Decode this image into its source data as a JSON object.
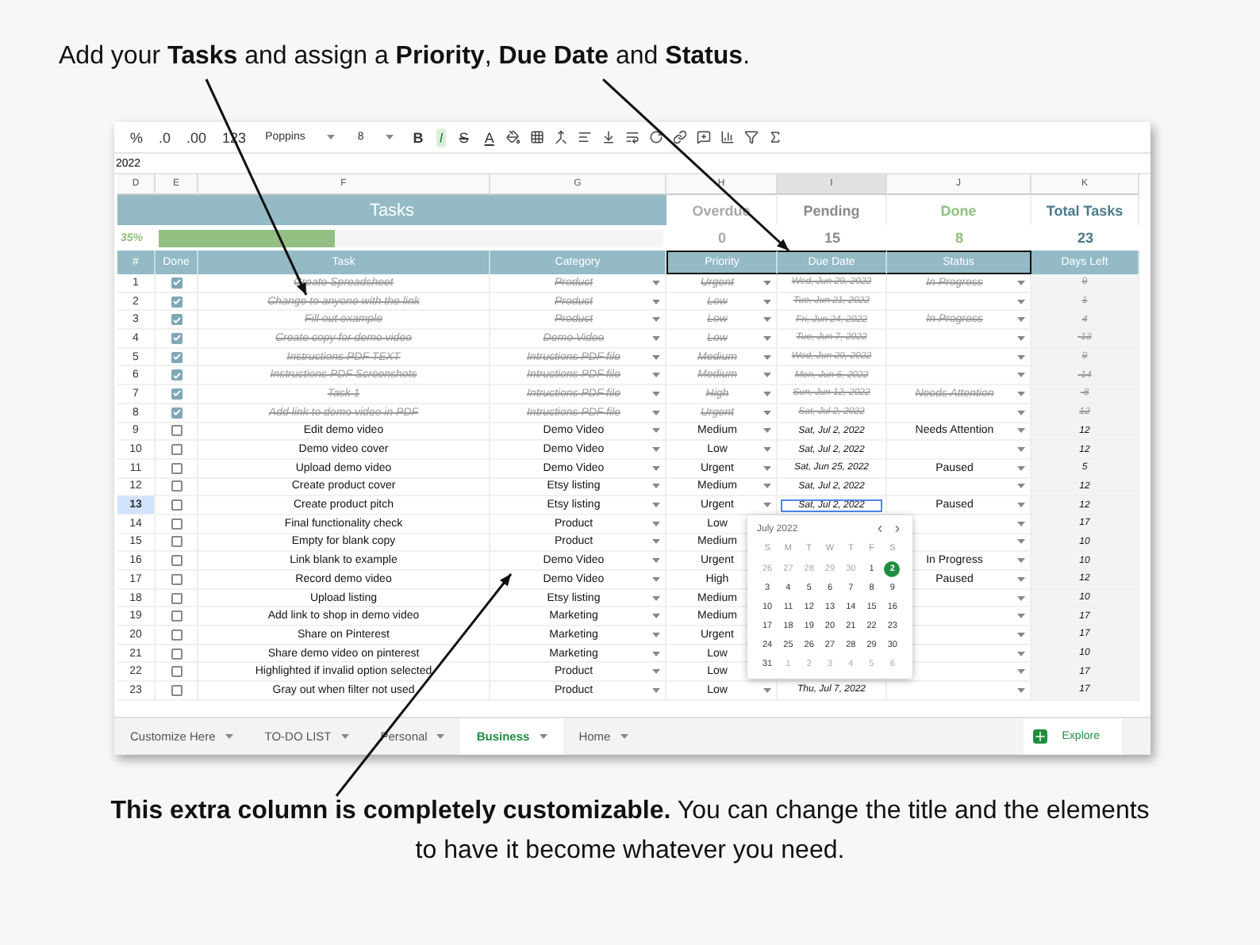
{
  "heading": "Add your **Tasks** and assign a **Priority**, **Due Date** and **Status**.",
  "toolbar": {
    "number_formats": [
      "%",
      ".0",
      ".00",
      "123"
    ],
    "font": "Poppins",
    "font_size": "8",
    "styles": [
      {
        "label": "B",
        "kind": "bold",
        "selected": false
      },
      {
        "label": "I",
        "kind": "italic",
        "selected": true
      },
      {
        "label": "S",
        "kind": "strike",
        "selected": false
      },
      {
        "label": "A",
        "kind": "color",
        "selected": false
      }
    ]
  },
  "formula_bar": "2022",
  "column_letters": [
    {
      "label": "D",
      "selected": false
    },
    {
      "label": "E",
      "selected": false
    },
    {
      "label": "F",
      "selected": false
    },
    {
      "label": "G",
      "selected": false
    },
    {
      "label": "H",
      "selected": false
    },
    {
      "label": "I",
      "selected": true
    },
    {
      "label": "J",
      "selected": false
    },
    {
      "label": "K",
      "selected": false
    }
  ],
  "title": "Tasks",
  "progress": {
    "label": "35%",
    "level": 0.35
  },
  "stats": [
    {
      "label": "Overdue",
      "value": "0",
      "color": "#a9a9a9"
    },
    {
      "label": "Pending",
      "value": "15",
      "color": "#8a8a8a"
    },
    {
      "label": "Done",
      "value": "8",
      "color": "#8fbf7f"
    },
    {
      "label": "Total Tasks",
      "value": "23",
      "color": "#4a7a88"
    }
  ],
  "columns": [
    {
      "label": "#",
      "highlighted": false
    },
    {
      "label": "Done",
      "highlighted": false
    },
    {
      "label": "Task",
      "highlighted": false
    },
    {
      "label": "Category",
      "highlighted": false
    },
    {
      "label": "Priority",
      "highlighted": true
    },
    {
      "label": "Due Date",
      "highlighted": true
    },
    {
      "label": "Status",
      "highlighted": true
    },
    {
      "label": "Days Left",
      "highlighted": false
    }
  ],
  "rows": [
    {
      "n": "1",
      "done": true,
      "task": "Create Spreadsheet",
      "category": "Product",
      "priority": "Urgent",
      "due": "Wed, Jun 29, 2022",
      "status": "In Progress",
      "days": "9",
      "selected": false
    },
    {
      "n": "2",
      "done": true,
      "task": "Change to anyone with the link",
      "category": "Product",
      "priority": "Low",
      "due": "Tue, Jun 21, 2022",
      "days": "1",
      "selected": false
    },
    {
      "n": "3",
      "done": true,
      "task": "Fill out example",
      "category": "Product",
      "priority": "Low",
      "due": "Fri, Jun 24, 2022",
      "status": "In Progress",
      "days": "4",
      "selected": false
    },
    {
      "n": "4",
      "done": true,
      "task": "Create copy for demo video",
      "category": "Demo Video",
      "priority": "Low",
      "due": "Tue, Jun 7, 2022",
      "days": "-13",
      "selected": false
    },
    {
      "n": "5",
      "done": true,
      "task": "Instructions PDF TEXT",
      "category": "Intructions PDF file",
      "priority": "Medium",
      "due": "Wed, Jun 29, 2022",
      "days": "9",
      "selected": false
    },
    {
      "n": "6",
      "done": true,
      "task": "Instructions PDF Screenshots",
      "category": "Intructions PDF file",
      "priority": "Medium",
      "due": "Mon, Jun 6, 2022",
      "days": "-14",
      "selected": false
    },
    {
      "n": "7",
      "done": true,
      "task": "Task 1",
      "category": "Intructions PDF file",
      "priority": "High",
      "due": "Sun, Jun 12, 2022",
      "status": "Needs Attention",
      "days": "-8",
      "selected": false
    },
    {
      "n": "8",
      "done": true,
      "task": "Add link to demo video in PDF",
      "category": "Intructions PDF file",
      "priority": "Urgent",
      "due": "Sat, Jul 2, 2022",
      "days": "12",
      "selected": false
    },
    {
      "n": "9",
      "done": false,
      "task": "Edit demo video",
      "category": "Demo Video",
      "priority": "Medium",
      "due": "Sat, Jul 2, 2022",
      "status": "Needs Attention",
      "days": "12",
      "selected": false
    },
    {
      "n": "10",
      "done": false,
      "task": "Demo video cover",
      "category": "Demo Video",
      "priority": "Low",
      "due": "Sat, Jul 2, 2022",
      "days": "12",
      "selected": false
    },
    {
      "n": "11",
      "done": false,
      "task": "Upload demo video",
      "category": "Demo Video",
      "priority": "Urgent",
      "due": "Sat, Jun 25, 2022",
      "status": "Paused",
      "days": "5",
      "selected": false
    },
    {
      "n": "12",
      "done": false,
      "task": "Create product cover",
      "category": "Etsy listing",
      "priority": "Medium",
      "due": "Sat, Jul 2, 2022",
      "days": "12",
      "selected": false
    },
    {
      "n": "13",
      "done": false,
      "task": "Create product pitch",
      "category": "Etsy listing",
      "priority": "Urgent",
      "due": "Sat, Jul 2, 2022",
      "status": "Paused",
      "days": "12",
      "selected": true
    },
    {
      "n": "14",
      "done": false,
      "task": "Final functionality check",
      "category": "Product",
      "priority": "Low",
      "days": "17",
      "selected": false
    },
    {
      "n": "15",
      "done": false,
      "task": "Empty for blank copy",
      "category": "Product",
      "priority": "Medium",
      "days": "10",
      "selected": false
    },
    {
      "n": "16",
      "done": false,
      "task": "Link blank to example",
      "category": "Demo Video",
      "priority": "Urgent",
      "status": "In Progress",
      "days": "10",
      "selected": false
    },
    {
      "n": "17",
      "done": false,
      "task": "Record demo video",
      "category": "Demo Video",
      "priority": "High",
      "status": "Paused",
      "days": "12",
      "selected": false
    },
    {
      "n": "18",
      "done": false,
      "task": "Upload listing",
      "category": "Etsy listing",
      "priority": "Medium",
      "days": "10",
      "selected": false
    },
    {
      "n": "19",
      "done": false,
      "task": "Add link to shop in demo video",
      "category": "Marketing",
      "priority": "Medium",
      "days": "17",
      "selected": false
    },
    {
      "n": "20",
      "done": false,
      "task": "Share on Pinterest",
      "category": "Marketing",
      "priority": "Urgent",
      "days": "17",
      "selected": false
    },
    {
      "n": "21",
      "done": false,
      "task": "Share demo video on pinterest",
      "category": "Marketing",
      "priority": "Low",
      "days": "10",
      "selected": false
    },
    {
      "n": "22",
      "done": false,
      "task": "Highlighted if invalid option selected",
      "category": "Product",
      "priority": "Low",
      "days": "17",
      "selected": false
    },
    {
      "n": "23",
      "done": false,
      "task": "Gray out when filter not used",
      "category": "Product",
      "priority": "Low",
      "due": "Thu, Jul 7, 2022",
      "days": "17",
      "selected": false
    }
  ],
  "calendar": {
    "month": "July 2022",
    "weekdays": [
      "S",
      "M",
      "T",
      "W",
      "T",
      "F",
      "S"
    ],
    "days": [
      {
        "label": "26",
        "other": true,
        "selected": false
      },
      {
        "label": "27",
        "other": true,
        "selected": false
      },
      {
        "label": "28",
        "other": true,
        "selected": false
      },
      {
        "label": "29",
        "other": true,
        "selected": false
      },
      {
        "label": "30",
        "other": true,
        "selected": false
      },
      {
        "label": "1",
        "other": false,
        "selected": false
      },
      {
        "label": "2",
        "other": false,
        "selected": true
      },
      {
        "label": "3",
        "other": false,
        "selected": false
      },
      {
        "label": "4",
        "other": false,
        "selected": false
      },
      {
        "label": "5",
        "other": false,
        "selected": false
      },
      {
        "label": "6",
        "other": false,
        "selected": false
      },
      {
        "label": "7",
        "other": false,
        "selected": false
      },
      {
        "label": "8",
        "other": false,
        "selected": false
      },
      {
        "label": "9",
        "other": false,
        "selected": false
      },
      {
        "label": "10",
        "other": false,
        "selected": false
      },
      {
        "label": "11",
        "other": false,
        "selected": false
      },
      {
        "label": "12",
        "other": false,
        "selected": false
      },
      {
        "label": "13",
        "other": false,
        "selected": false
      },
      {
        "label": "14",
        "other": false,
        "selected": false
      },
      {
        "label": "15",
        "other": false,
        "selected": false
      },
      {
        "label": "16",
        "other": false,
        "selected": false
      },
      {
        "label": "17",
        "other": false,
        "selected": false
      },
      {
        "label": "18",
        "other": false,
        "selected": false
      },
      {
        "label": "19",
        "other": false,
        "selected": false
      },
      {
        "label": "20",
        "other": false,
        "selected": false
      },
      {
        "label": "21",
        "other": false,
        "selected": false
      },
      {
        "label": "22",
        "other": false,
        "selected": false
      },
      {
        "label": "23",
        "other": false,
        "selected": false
      },
      {
        "label": "24",
        "other": false,
        "selected": false
      },
      {
        "label": "25",
        "other": false,
        "selected": false
      },
      {
        "label": "26",
        "other": false,
        "selected": false
      },
      {
        "label": "27",
        "other": false,
        "selected": false
      },
      {
        "label": "28",
        "other": false,
        "selected": false
      },
      {
        "label": "29",
        "other": false,
        "selected": false
      },
      {
        "label": "30",
        "other": false,
        "selected": false
      },
      {
        "label": "31",
        "other": false,
        "selected": false
      },
      {
        "label": "1",
        "other": true,
        "selected": false
      },
      {
        "label": "2",
        "other": true,
        "selected": false
      },
      {
        "label": "3",
        "other": true,
        "selected": false
      },
      {
        "label": "4",
        "other": true,
        "selected": false
      },
      {
        "label": "5",
        "other": true,
        "selected": false
      },
      {
        "label": "6",
        "other": true,
        "selected": false
      }
    ]
  },
  "sheet_tabs": [
    {
      "label": "Customize Here",
      "selected": false
    },
    {
      "label": "TO-DO LIST",
      "selected": false
    },
    {
      "label": "Personal",
      "selected": false
    },
    {
      "label": "Business",
      "selected": true
    },
    {
      "label": "Home",
      "selected": false
    }
  ],
  "explore": "Explore",
  "caption": "**This extra column is completely customizable.** You can change the title and the elements to have it become whatever you need."
}
